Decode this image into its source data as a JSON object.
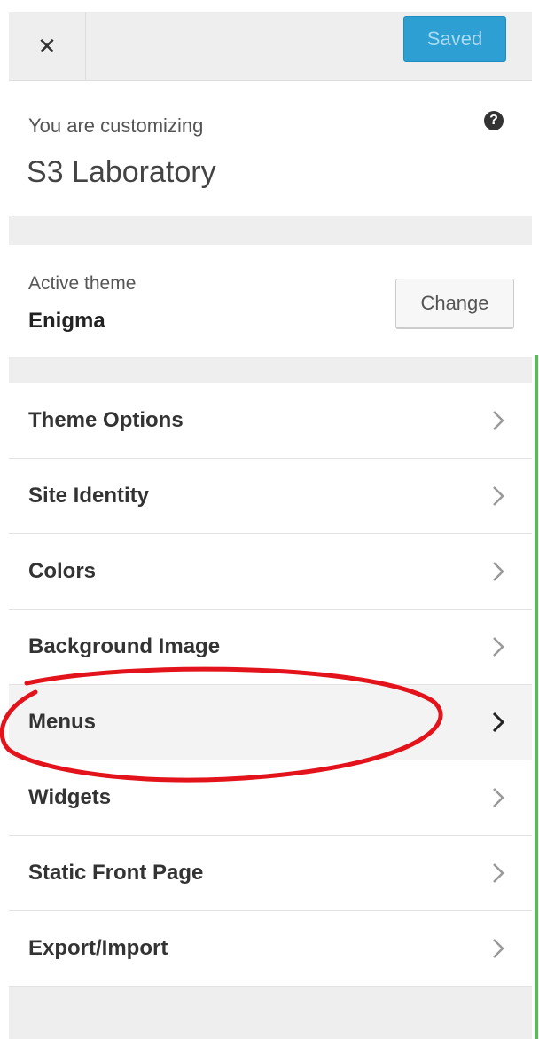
{
  "header": {
    "close_icon": "close-icon",
    "close_glyph": "✕",
    "saved_label": "Saved"
  },
  "info": {
    "label": "You are customizing",
    "site_title": "S3 Laboratory",
    "help_icon": "help-icon",
    "help_glyph": "?"
  },
  "theme": {
    "label": "Active theme",
    "name": "Enigma",
    "change_label": "Change"
  },
  "menu": {
    "items": [
      {
        "label": "Theme Options"
      },
      {
        "label": "Site Identity"
      },
      {
        "label": "Colors"
      },
      {
        "label": "Background Image"
      },
      {
        "label": "Menus"
      },
      {
        "label": "Widgets"
      },
      {
        "label": "Static Front Page"
      },
      {
        "label": "Export/Import"
      }
    ],
    "chevron_icon": "chevron-right-icon"
  },
  "colors": {
    "accent": "#2e9fd3",
    "annotation": "#e3131b",
    "strip": "#5cb85c"
  }
}
